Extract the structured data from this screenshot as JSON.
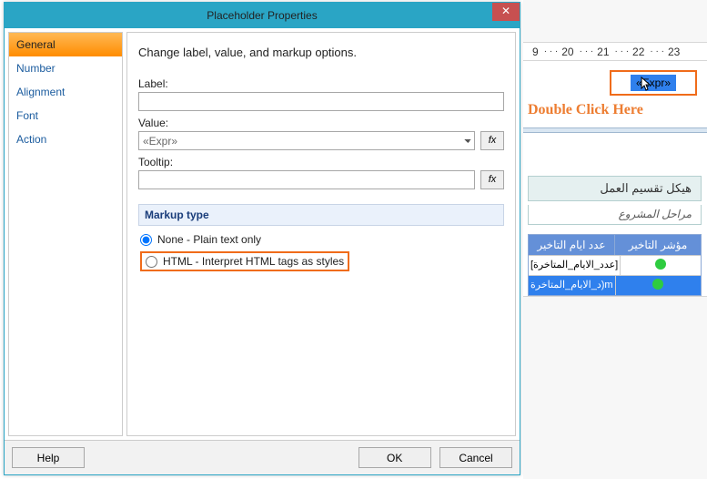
{
  "dialog": {
    "title": "Placeholder Properties",
    "close": "✕",
    "sidebar": {
      "items": [
        {
          "label": "General"
        },
        {
          "label": "Number"
        },
        {
          "label": "Alignment"
        },
        {
          "label": "Font"
        },
        {
          "label": "Action"
        }
      ]
    },
    "heading": "Change label, value, and markup options.",
    "labels": {
      "label": "Label:",
      "value": "Value:",
      "tooltip": "Tooltip:"
    },
    "values": {
      "value_selected": "«Expr»"
    },
    "fx": "fx",
    "markup": {
      "header": "Markup type",
      "options": [
        "None - Plain text only",
        "HTML - Interpret HTML tags as styles"
      ]
    },
    "footer": {
      "help": "Help",
      "ok": "OK",
      "cancel": "Cancel"
    }
  },
  "bg": {
    "ruler": [
      "9",
      "20",
      "21",
      "22",
      "23"
    ],
    "expr_text": "«Expr»",
    "annotation": "Double Click Here",
    "wbs_title": "هيكل تقسيم العمل",
    "wbs_sub": "مراحل المشروع",
    "table": {
      "headers": [
        "مؤشر التاخير",
        "عدد ايام التاخير"
      ],
      "rows": [
        {
          "cell": "[عدد_الايام_المتاخرة]"
        },
        {
          "cell": "m(د_الايام_المتاخرة"
        }
      ]
    }
  }
}
